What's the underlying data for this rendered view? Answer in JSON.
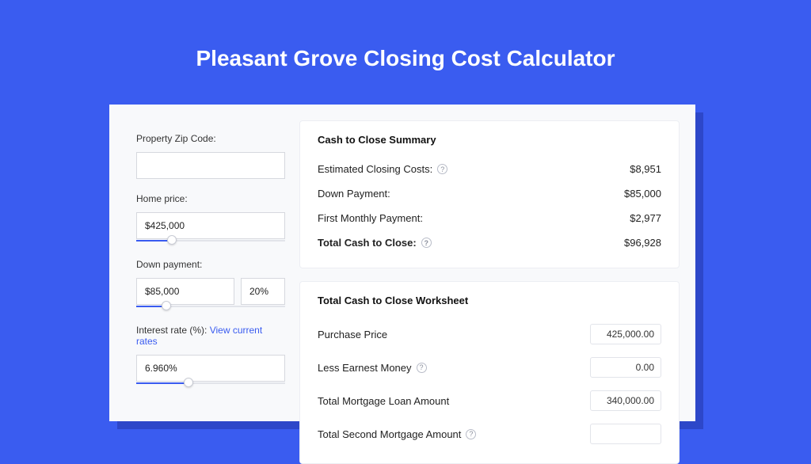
{
  "title": "Pleasant Grove Closing Cost Calculator",
  "left": {
    "zip_label": "Property Zip Code:",
    "zip_value": "",
    "price_label": "Home price:",
    "price_value": "$425,000",
    "price_slider_pct": 24,
    "down_label": "Down payment:",
    "down_value": "$85,000",
    "down_pct_value": "20%",
    "down_slider_pct": 20,
    "rate_label": "Interest rate (%): ",
    "rate_link": "View current rates",
    "rate_value": "6.960%",
    "rate_slider_pct": 35
  },
  "summary": {
    "title": "Cash to Close Summary",
    "rows": [
      {
        "label": "Estimated Closing Costs:",
        "help": true,
        "value": "$8,951"
      },
      {
        "label": "Down Payment:",
        "help": false,
        "value": "$85,000"
      },
      {
        "label": "First Monthly Payment:",
        "help": false,
        "value": "$2,977"
      }
    ],
    "total_label": "Total Cash to Close:",
    "total_value": "$96,928"
  },
  "worksheet": {
    "title": "Total Cash to Close Worksheet",
    "rows": [
      {
        "label": "Purchase Price",
        "help": false,
        "value": "425,000.00"
      },
      {
        "label": "Less Earnest Money",
        "help": true,
        "value": "0.00"
      },
      {
        "label": "Total Mortgage Loan Amount",
        "help": false,
        "value": "340,000.00"
      },
      {
        "label": "Total Second Mortgage Amount",
        "help": true,
        "value": ""
      }
    ]
  }
}
